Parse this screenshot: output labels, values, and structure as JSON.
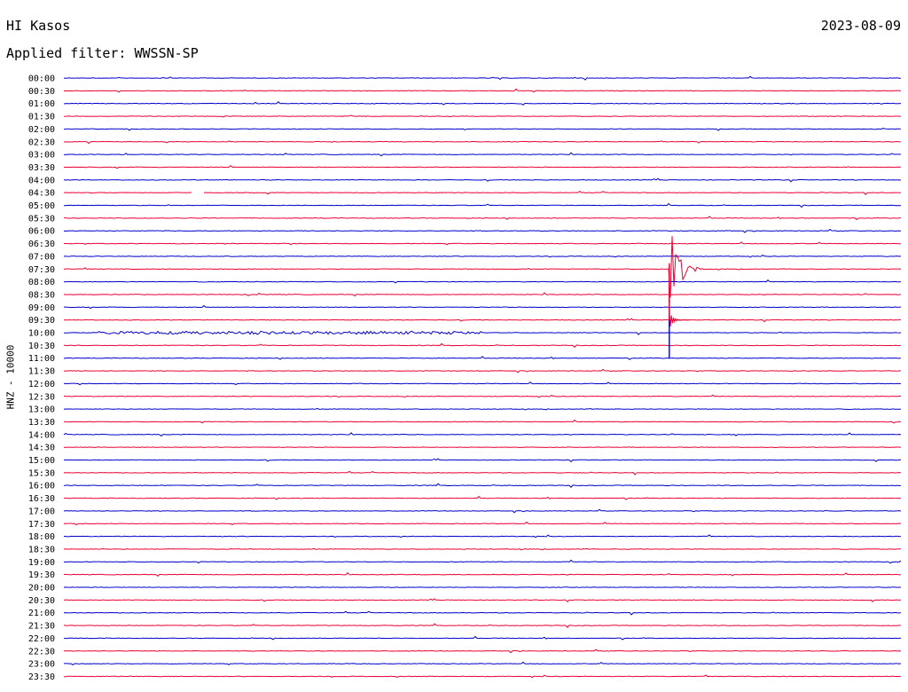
{
  "header": {
    "station": "HI Kasos",
    "date": "2023-08-09",
    "filter": "Applied filter: WWSSN-SP"
  },
  "chart_data": {
    "type": "line",
    "ylabel": "HNZ - 10000",
    "trace_colors": [
      "#0000cc",
      "#ee0033"
    ],
    "rows": [
      "00:00",
      "00:30",
      "01:00",
      "01:30",
      "02:00",
      "02:30",
      "03:00",
      "03:30",
      "04:00",
      "04:30",
      "05:00",
      "05:30",
      "06:00",
      "06:30",
      "07:00",
      "07:30",
      "08:00",
      "08:30",
      "09:00",
      "09:30",
      "10:00",
      "10:30",
      "11:00",
      "11:30",
      "12:00",
      "12:30",
      "13:00",
      "13:30",
      "14:00",
      "14:30",
      "15:00",
      "15:30",
      "16:00",
      "16:30",
      "17:00",
      "17:30",
      "18:00",
      "18:30",
      "19:00",
      "19:30",
      "20:00",
      "20:30",
      "21:00",
      "21:30",
      "22:00",
      "22:30",
      "23:00",
      "23:30"
    ],
    "x_range_minutes": [
      0,
      30
    ],
    "events": [
      {
        "row": "07:30",
        "minute": 21.7,
        "amplitude_rows": 4.6,
        "note": "large earthquake, decays through 09:30"
      },
      {
        "row": "10:00",
        "minute": 1.2,
        "duration_min": 13.8,
        "amplitude_rows": 0.1,
        "note": "sustained low-level noise band"
      },
      {
        "row": "04:30",
        "gap_start_min": 4.6,
        "gap_end_min": 5.0,
        "note": "data gap"
      },
      {
        "row": "06:30",
        "minute": 5.6,
        "amplitude_rows": 0.06
      }
    ]
  }
}
